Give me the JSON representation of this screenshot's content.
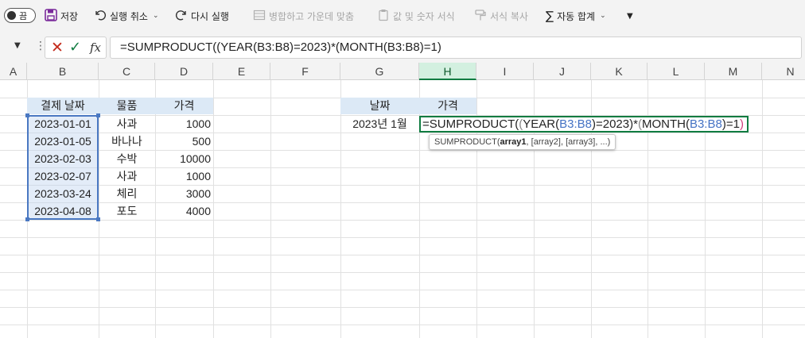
{
  "toolbar": {
    "toggle_label": "끔",
    "save_label": "저장",
    "undo_label": "실행 취소",
    "redo_label": "다시 실행",
    "merge_label": "병합하고 가운데 맞춤",
    "paste_values_label": "값 및 숫자 서식",
    "format_painter_label": "서식 복사",
    "autosum_label": "자동 합계",
    "save_icon_color": "#7a2a9b"
  },
  "formula_bar": {
    "formula": "=SUMPRODUCT((YEAR(B3:B8)=2023)*(MONTH(B3:B8)=1)",
    "fx_label": "fx"
  },
  "columns": [
    "A",
    "B",
    "C",
    "D",
    "E",
    "F",
    "G",
    "H",
    "I",
    "J",
    "K",
    "L",
    "M",
    "N"
  ],
  "active_column": "H",
  "table": {
    "headers": [
      "결제 날짜",
      "물품",
      "가격"
    ],
    "rows": [
      [
        "2023-01-01",
        "사과",
        "1000"
      ],
      [
        "2023-01-05",
        "바나나",
        "500"
      ],
      [
        "2023-02-03",
        "수박",
        "10000"
      ],
      [
        "2023-02-07",
        "사과",
        "1000"
      ],
      [
        "2023-03-24",
        "체리",
        "3000"
      ],
      [
        "2023-04-08",
        "포도",
        "4000"
      ]
    ]
  },
  "lookup": {
    "headers": [
      "날짜",
      "가격"
    ],
    "date_label": "2023년 1월"
  },
  "edit_cell": {
    "p1": "=SUMPRODUCT(",
    "p2": "(",
    "p3": "YEAR(",
    "ref1": "B3:B8",
    "p4": ")=2023)*",
    "p5": "(",
    "p6": "MONTH(",
    "ref2": "B3:B8",
    "p7": ")=1",
    "p8": ")"
  },
  "tooltip": {
    "fn": "SUMPRODUCT(",
    "arg1": "array1",
    "rest": ", [array2], [array3], ...)"
  },
  "colors": {
    "accent_green": "#107c41",
    "range_blue": "#4a78c2",
    "header_fill": "#dce9f6"
  }
}
